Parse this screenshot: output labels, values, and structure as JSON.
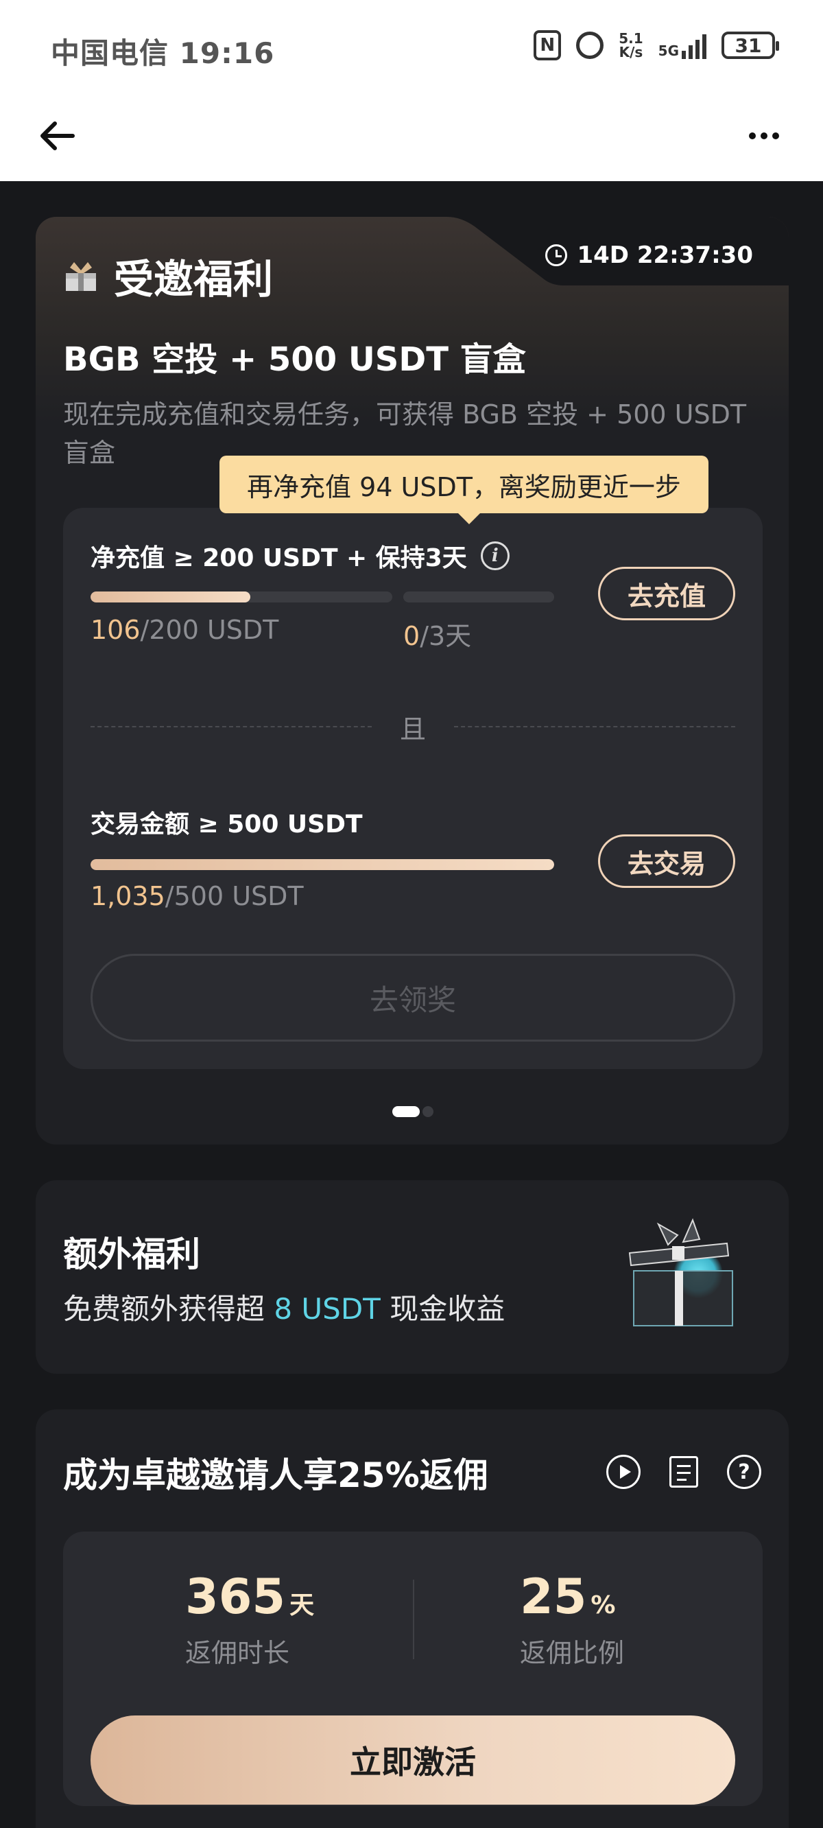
{
  "status_bar": {
    "carrier_time": "中国电信 19:16",
    "nfc": "N",
    "net_speed_top": "5.1",
    "net_speed_bottom": "K/s",
    "network": "5G",
    "battery": "31"
  },
  "header": {
    "back_icon": "arrow-left-icon",
    "more_icon": "more-horizontal-icon"
  },
  "invite_card": {
    "title": "受邀福利",
    "countdown": "14D 22:37:30",
    "subtitle": "BGB 空投 + 500 USDT 盲盒",
    "description": "现在完成充值和交易任务，可获得 BGB 空投 + 500 USDT 盲盒",
    "tooltip": "再净充值 94 USDT，离奖励更近一步",
    "task1": {
      "label": "净充值 ≥ 200 USDT + 保持3天",
      "info_icon": "i",
      "amount_current": "106",
      "amount_total": "/200 USDT",
      "amount_progress": 0.53,
      "days_current": "0",
      "days_total": "/3天",
      "days_progress": 0,
      "button": "去充值"
    },
    "and_label": "且",
    "task2": {
      "label": "交易金额 ≥ 500 USDT",
      "amount_current": "1,035",
      "amount_total": "/500 USDT",
      "amount_progress": 1,
      "button": "去交易"
    },
    "claim_button": "去领奖",
    "pager": {
      "current": 1,
      "total": 2
    }
  },
  "extra_card": {
    "title": "额外福利",
    "desc_prefix": "免费额外获得超 ",
    "desc_accent": "8 USDT",
    "desc_suffix": " 现金收益",
    "accent_color": "#5fd4e6",
    "illustration": "gift-box-icon"
  },
  "referrer_card": {
    "title": "成为卓越邀请人享25%返佣",
    "icons": [
      "play-icon",
      "document-icon",
      "help-icon"
    ],
    "help_glyph": "?",
    "stats": [
      {
        "value": "365",
        "unit": "天",
        "label": "返佣时长"
      },
      {
        "value": "25",
        "unit": "%",
        "label": "返佣比例"
      }
    ],
    "activate_button": "立即激活"
  }
}
